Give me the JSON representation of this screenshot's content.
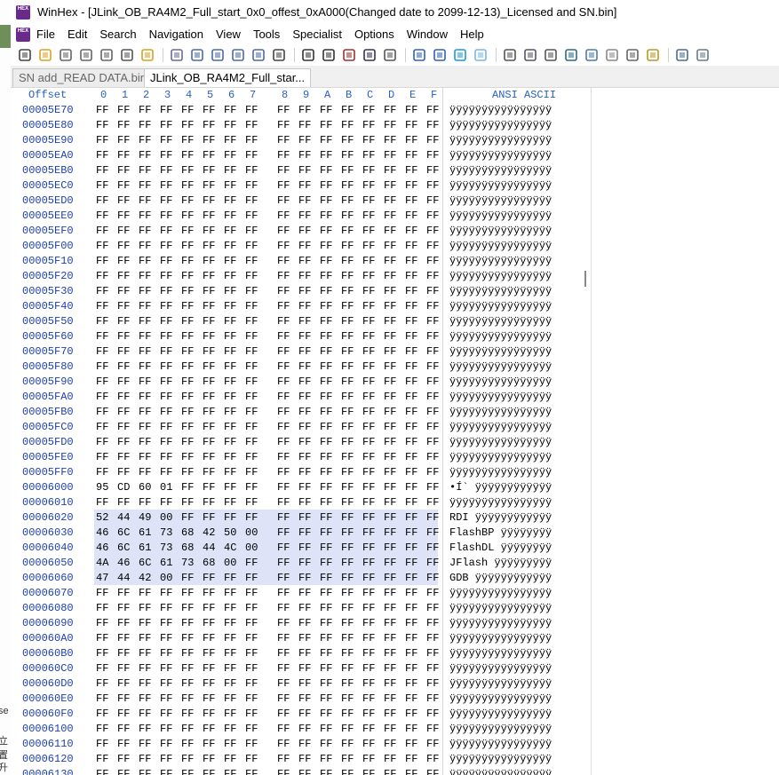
{
  "window": {
    "title": "WinHex - [JLink_OB_RA4M2_Full_start_0x0_offest_0xA000(Changed date to 2099-12-13)_Licensed and SN.bin]",
    "icon": "HEX",
    "icon_name": "winhex-app-icon"
  },
  "menu": [
    "File",
    "Edit",
    "Search",
    "Navigation",
    "View",
    "Tools",
    "Specialist",
    "Options",
    "Window",
    "Help"
  ],
  "toolbar": {
    "icons": [
      "new-file-icon",
      "open-icon",
      "save-icon",
      "save-all-icon",
      "print-icon",
      "properties-icon",
      "open-folder-icon",
      "undo-icon",
      "copy-icon",
      "paste-icon",
      "paste-special-icon",
      "copy-hex-icon",
      "binary-icon",
      "find-icon",
      "find-hex-icon",
      "replace-icon",
      "replace-hex-icon",
      "find-next-icon",
      "goto-offset-icon",
      "goto-end-icon",
      "back-icon",
      "forward-icon",
      "disk-icon",
      "open-disk-icon",
      "ram-icon",
      "calculator-icon",
      "search-icon",
      "hash-icon",
      "tools-icon",
      "options-icon",
      "layout-icon",
      "grid-icon"
    ]
  },
  "tabs": [
    {
      "label": "SN add_READ DATA.bin",
      "active": false
    },
    {
      "label": "JLink_OB_RA4M2_Full_star...",
      "active": true
    }
  ],
  "hex_editor": {
    "offset_label": "Offset",
    "columns": [
      "0",
      "1",
      "2",
      "3",
      "4",
      "5",
      "6",
      "7",
      "8",
      "9",
      "A",
      "B",
      "C",
      "D",
      "E",
      "F"
    ],
    "ascii_label": "ANSI ASCII",
    "rows": [
      {
        "offset": "00005E70",
        "bytes": [
          "FF",
          "FF",
          "FF",
          "FF",
          "FF",
          "FF",
          "FF",
          "FF",
          "FF",
          "FF",
          "FF",
          "FF",
          "FF",
          "FF",
          "FF",
          "FF"
        ],
        "ascii": "ÿÿÿÿÿÿÿÿÿÿÿÿÿÿÿÿ",
        "selected": false
      },
      {
        "offset": "00005E80",
        "bytes": [
          "FF",
          "FF",
          "FF",
          "FF",
          "FF",
          "FF",
          "FF",
          "FF",
          "FF",
          "FF",
          "FF",
          "FF",
          "FF",
          "FF",
          "FF",
          "FF"
        ],
        "ascii": "ÿÿÿÿÿÿÿÿÿÿÿÿÿÿÿÿ",
        "selected": false
      },
      {
        "offset": "00005E90",
        "bytes": [
          "FF",
          "FF",
          "FF",
          "FF",
          "FF",
          "FF",
          "FF",
          "FF",
          "FF",
          "FF",
          "FF",
          "FF",
          "FF",
          "FF",
          "FF",
          "FF"
        ],
        "ascii": "ÿÿÿÿÿÿÿÿÿÿÿÿÿÿÿÿ",
        "selected": false
      },
      {
        "offset": "00005EA0",
        "bytes": [
          "FF",
          "FF",
          "FF",
          "FF",
          "FF",
          "FF",
          "FF",
          "FF",
          "FF",
          "FF",
          "FF",
          "FF",
          "FF",
          "FF",
          "FF",
          "FF"
        ],
        "ascii": "ÿÿÿÿÿÿÿÿÿÿÿÿÿÿÿÿ",
        "selected": false
      },
      {
        "offset": "00005EB0",
        "bytes": [
          "FF",
          "FF",
          "FF",
          "FF",
          "FF",
          "FF",
          "FF",
          "FF",
          "FF",
          "FF",
          "FF",
          "FF",
          "FF",
          "FF",
          "FF",
          "FF"
        ],
        "ascii": "ÿÿÿÿÿÿÿÿÿÿÿÿÿÿÿÿ",
        "selected": false
      },
      {
        "offset": "00005EC0",
        "bytes": [
          "FF",
          "FF",
          "FF",
          "FF",
          "FF",
          "FF",
          "FF",
          "FF",
          "FF",
          "FF",
          "FF",
          "FF",
          "FF",
          "FF",
          "FF",
          "FF"
        ],
        "ascii": "ÿÿÿÿÿÿÿÿÿÿÿÿÿÿÿÿ",
        "selected": false
      },
      {
        "offset": "00005ED0",
        "bytes": [
          "FF",
          "FF",
          "FF",
          "FF",
          "FF",
          "FF",
          "FF",
          "FF",
          "FF",
          "FF",
          "FF",
          "FF",
          "FF",
          "FF",
          "FF",
          "FF"
        ],
        "ascii": "ÿÿÿÿÿÿÿÿÿÿÿÿÿÿÿÿ",
        "selected": false
      },
      {
        "offset": "00005EE0",
        "bytes": [
          "FF",
          "FF",
          "FF",
          "FF",
          "FF",
          "FF",
          "FF",
          "FF",
          "FF",
          "FF",
          "FF",
          "FF",
          "FF",
          "FF",
          "FF",
          "FF"
        ],
        "ascii": "ÿÿÿÿÿÿÿÿÿÿÿÿÿÿÿÿ",
        "selected": false
      },
      {
        "offset": "00005EF0",
        "bytes": [
          "FF",
          "FF",
          "FF",
          "FF",
          "FF",
          "FF",
          "FF",
          "FF",
          "FF",
          "FF",
          "FF",
          "FF",
          "FF",
          "FF",
          "FF",
          "FF"
        ],
        "ascii": "ÿÿÿÿÿÿÿÿÿÿÿÿÿÿÿÿ",
        "selected": false
      },
      {
        "offset": "00005F00",
        "bytes": [
          "FF",
          "FF",
          "FF",
          "FF",
          "FF",
          "FF",
          "FF",
          "FF",
          "FF",
          "FF",
          "FF",
          "FF",
          "FF",
          "FF",
          "FF",
          "FF"
        ],
        "ascii": "ÿÿÿÿÿÿÿÿÿÿÿÿÿÿÿÿ",
        "selected": false
      },
      {
        "offset": "00005F10",
        "bytes": [
          "FF",
          "FF",
          "FF",
          "FF",
          "FF",
          "FF",
          "FF",
          "FF",
          "FF",
          "FF",
          "FF",
          "FF",
          "FF",
          "FF",
          "FF",
          "FF"
        ],
        "ascii": "ÿÿÿÿÿÿÿÿÿÿÿÿÿÿÿÿ",
        "selected": false
      },
      {
        "offset": "00005F20",
        "bytes": [
          "FF",
          "FF",
          "FF",
          "FF",
          "FF",
          "FF",
          "FF",
          "FF",
          "FF",
          "FF",
          "FF",
          "FF",
          "FF",
          "FF",
          "FF",
          "FF"
        ],
        "ascii": "ÿÿÿÿÿÿÿÿÿÿÿÿÿÿÿÿ",
        "selected": false
      },
      {
        "offset": "00005F30",
        "bytes": [
          "FF",
          "FF",
          "FF",
          "FF",
          "FF",
          "FF",
          "FF",
          "FF",
          "FF",
          "FF",
          "FF",
          "FF",
          "FF",
          "FF",
          "FF",
          "FF"
        ],
        "ascii": "ÿÿÿÿÿÿÿÿÿÿÿÿÿÿÿÿ",
        "selected": false
      },
      {
        "offset": "00005F40",
        "bytes": [
          "FF",
          "FF",
          "FF",
          "FF",
          "FF",
          "FF",
          "FF",
          "FF",
          "FF",
          "FF",
          "FF",
          "FF",
          "FF",
          "FF",
          "FF",
          "FF"
        ],
        "ascii": "ÿÿÿÿÿÿÿÿÿÿÿÿÿÿÿÿ",
        "selected": false
      },
      {
        "offset": "00005F50",
        "bytes": [
          "FF",
          "FF",
          "FF",
          "FF",
          "FF",
          "FF",
          "FF",
          "FF",
          "FF",
          "FF",
          "FF",
          "FF",
          "FF",
          "FF",
          "FF",
          "FF"
        ],
        "ascii": "ÿÿÿÿÿÿÿÿÿÿÿÿÿÿÿÿ",
        "selected": false
      },
      {
        "offset": "00005F60",
        "bytes": [
          "FF",
          "FF",
          "FF",
          "FF",
          "FF",
          "FF",
          "FF",
          "FF",
          "FF",
          "FF",
          "FF",
          "FF",
          "FF",
          "FF",
          "FF",
          "FF"
        ],
        "ascii": "ÿÿÿÿÿÿÿÿÿÿÿÿÿÿÿÿ",
        "selected": false
      },
      {
        "offset": "00005F70",
        "bytes": [
          "FF",
          "FF",
          "FF",
          "FF",
          "FF",
          "FF",
          "FF",
          "FF",
          "FF",
          "FF",
          "FF",
          "FF",
          "FF",
          "FF",
          "FF",
          "FF"
        ],
        "ascii": "ÿÿÿÿÿÿÿÿÿÿÿÿÿÿÿÿ",
        "selected": false
      },
      {
        "offset": "00005F80",
        "bytes": [
          "FF",
          "FF",
          "FF",
          "FF",
          "FF",
          "FF",
          "FF",
          "FF",
          "FF",
          "FF",
          "FF",
          "FF",
          "FF",
          "FF",
          "FF",
          "FF"
        ],
        "ascii": "ÿÿÿÿÿÿÿÿÿÿÿÿÿÿÿÿ",
        "selected": false
      },
      {
        "offset": "00005F90",
        "bytes": [
          "FF",
          "FF",
          "FF",
          "FF",
          "FF",
          "FF",
          "FF",
          "FF",
          "FF",
          "FF",
          "FF",
          "FF",
          "FF",
          "FF",
          "FF",
          "FF"
        ],
        "ascii": "ÿÿÿÿÿÿÿÿÿÿÿÿÿÿÿÿ",
        "selected": false
      },
      {
        "offset": "00005FA0",
        "bytes": [
          "FF",
          "FF",
          "FF",
          "FF",
          "FF",
          "FF",
          "FF",
          "FF",
          "FF",
          "FF",
          "FF",
          "FF",
          "FF",
          "FF",
          "FF",
          "FF"
        ],
        "ascii": "ÿÿÿÿÿÿÿÿÿÿÿÿÿÿÿÿ",
        "selected": false
      },
      {
        "offset": "00005FB0",
        "bytes": [
          "FF",
          "FF",
          "FF",
          "FF",
          "FF",
          "FF",
          "FF",
          "FF",
          "FF",
          "FF",
          "FF",
          "FF",
          "FF",
          "FF",
          "FF",
          "FF"
        ],
        "ascii": "ÿÿÿÿÿÿÿÿÿÿÿÿÿÿÿÿ",
        "selected": false
      },
      {
        "offset": "00005FC0",
        "bytes": [
          "FF",
          "FF",
          "FF",
          "FF",
          "FF",
          "FF",
          "FF",
          "FF",
          "FF",
          "FF",
          "FF",
          "FF",
          "FF",
          "FF",
          "FF",
          "FF"
        ],
        "ascii": "ÿÿÿÿÿÿÿÿÿÿÿÿÿÿÿÿ",
        "selected": false
      },
      {
        "offset": "00005FD0",
        "bytes": [
          "FF",
          "FF",
          "FF",
          "FF",
          "FF",
          "FF",
          "FF",
          "FF",
          "FF",
          "FF",
          "FF",
          "FF",
          "FF",
          "FF",
          "FF",
          "FF"
        ],
        "ascii": "ÿÿÿÿÿÿÿÿÿÿÿÿÿÿÿÿ",
        "selected": false
      },
      {
        "offset": "00005FE0",
        "bytes": [
          "FF",
          "FF",
          "FF",
          "FF",
          "FF",
          "FF",
          "FF",
          "FF",
          "FF",
          "FF",
          "FF",
          "FF",
          "FF",
          "FF",
          "FF",
          "FF"
        ],
        "ascii": "ÿÿÿÿÿÿÿÿÿÿÿÿÿÿÿÿ",
        "selected": false
      },
      {
        "offset": "00005FF0",
        "bytes": [
          "FF",
          "FF",
          "FF",
          "FF",
          "FF",
          "FF",
          "FF",
          "FF",
          "FF",
          "FF",
          "FF",
          "FF",
          "FF",
          "FF",
          "FF",
          "FF"
        ],
        "ascii": "ÿÿÿÿÿÿÿÿÿÿÿÿÿÿÿÿ",
        "selected": false
      },
      {
        "offset": "00006000",
        "bytes": [
          "95",
          "CD",
          "60",
          "01",
          "FF",
          "FF",
          "FF",
          "FF",
          "FF",
          "FF",
          "FF",
          "FF",
          "FF",
          "FF",
          "FF",
          "FF"
        ],
        "ascii": "•Í` ÿÿÿÿÿÿÿÿÿÿÿÿ",
        "selected": false
      },
      {
        "offset": "00006010",
        "bytes": [
          "FF",
          "FF",
          "FF",
          "FF",
          "FF",
          "FF",
          "FF",
          "FF",
          "FF",
          "FF",
          "FF",
          "FF",
          "FF",
          "FF",
          "FF",
          "FF"
        ],
        "ascii": "ÿÿÿÿÿÿÿÿÿÿÿÿÿÿÿÿ",
        "selected": false
      },
      {
        "offset": "00006020",
        "bytes": [
          "52",
          "44",
          "49",
          "00",
          "FF",
          "FF",
          "FF",
          "FF",
          "FF",
          "FF",
          "FF",
          "FF",
          "FF",
          "FF",
          "FF",
          "FF"
        ],
        "ascii": "RDI ÿÿÿÿÿÿÿÿÿÿÿÿ",
        "selected": true
      },
      {
        "offset": "00006030",
        "bytes": [
          "46",
          "6C",
          "61",
          "73",
          "68",
          "42",
          "50",
          "00",
          "FF",
          "FF",
          "FF",
          "FF",
          "FF",
          "FF",
          "FF",
          "FF"
        ],
        "ascii": "FlashBP ÿÿÿÿÿÿÿÿ",
        "selected": true
      },
      {
        "offset": "00006040",
        "bytes": [
          "46",
          "6C",
          "61",
          "73",
          "68",
          "44",
          "4C",
          "00",
          "FF",
          "FF",
          "FF",
          "FF",
          "FF",
          "FF",
          "FF",
          "FF"
        ],
        "ascii": "FlashDL ÿÿÿÿÿÿÿÿ",
        "selected": true
      },
      {
        "offset": "00006050",
        "bytes": [
          "4A",
          "46",
          "6C",
          "61",
          "73",
          "68",
          "00",
          "FF",
          "FF",
          "FF",
          "FF",
          "FF",
          "FF",
          "FF",
          "FF",
          "FF"
        ],
        "ascii": "JFlash ÿÿÿÿÿÿÿÿÿ",
        "selected": true
      },
      {
        "offset": "00006060",
        "bytes": [
          "47",
          "44",
          "42",
          "00",
          "FF",
          "FF",
          "FF",
          "FF",
          "FF",
          "FF",
          "FF",
          "FF",
          "FF",
          "FF",
          "FF",
          "FF"
        ],
        "ascii": "GDB ÿÿÿÿÿÿÿÿÿÿÿÿ",
        "selected": true
      },
      {
        "offset": "00006070",
        "bytes": [
          "FF",
          "FF",
          "FF",
          "FF",
          "FF",
          "FF",
          "FF",
          "FF",
          "FF",
          "FF",
          "FF",
          "FF",
          "FF",
          "FF",
          "FF",
          "FF"
        ],
        "ascii": "ÿÿÿÿÿÿÿÿÿÿÿÿÿÿÿÿ",
        "selected": false
      },
      {
        "offset": "00006080",
        "bytes": [
          "FF",
          "FF",
          "FF",
          "FF",
          "FF",
          "FF",
          "FF",
          "FF",
          "FF",
          "FF",
          "FF",
          "FF",
          "FF",
          "FF",
          "FF",
          "FF"
        ],
        "ascii": "ÿÿÿÿÿÿÿÿÿÿÿÿÿÿÿÿ",
        "selected": false
      },
      {
        "offset": "00006090",
        "bytes": [
          "FF",
          "FF",
          "FF",
          "FF",
          "FF",
          "FF",
          "FF",
          "FF",
          "FF",
          "FF",
          "FF",
          "FF",
          "FF",
          "FF",
          "FF",
          "FF"
        ],
        "ascii": "ÿÿÿÿÿÿÿÿÿÿÿÿÿÿÿÿ",
        "selected": false
      },
      {
        "offset": "000060A0",
        "bytes": [
          "FF",
          "FF",
          "FF",
          "FF",
          "FF",
          "FF",
          "FF",
          "FF",
          "FF",
          "FF",
          "FF",
          "FF",
          "FF",
          "FF",
          "FF",
          "FF"
        ],
        "ascii": "ÿÿÿÿÿÿÿÿÿÿÿÿÿÿÿÿ",
        "selected": false
      },
      {
        "offset": "000060B0",
        "bytes": [
          "FF",
          "FF",
          "FF",
          "FF",
          "FF",
          "FF",
          "FF",
          "FF",
          "FF",
          "FF",
          "FF",
          "FF",
          "FF",
          "FF",
          "FF",
          "FF"
        ],
        "ascii": "ÿÿÿÿÿÿÿÿÿÿÿÿÿÿÿÿ",
        "selected": false
      },
      {
        "offset": "000060C0",
        "bytes": [
          "FF",
          "FF",
          "FF",
          "FF",
          "FF",
          "FF",
          "FF",
          "FF",
          "FF",
          "FF",
          "FF",
          "FF",
          "FF",
          "FF",
          "FF",
          "FF"
        ],
        "ascii": "ÿÿÿÿÿÿÿÿÿÿÿÿÿÿÿÿ",
        "selected": false
      },
      {
        "offset": "000060D0",
        "bytes": [
          "FF",
          "FF",
          "FF",
          "FF",
          "FF",
          "FF",
          "FF",
          "FF",
          "FF",
          "FF",
          "FF",
          "FF",
          "FF",
          "FF",
          "FF",
          "FF"
        ],
        "ascii": "ÿÿÿÿÿÿÿÿÿÿÿÿÿÿÿÿ",
        "selected": false
      },
      {
        "offset": "000060E0",
        "bytes": [
          "FF",
          "FF",
          "FF",
          "FF",
          "FF",
          "FF",
          "FF",
          "FF",
          "FF",
          "FF",
          "FF",
          "FF",
          "FF",
          "FF",
          "FF",
          "FF"
        ],
        "ascii": "ÿÿÿÿÿÿÿÿÿÿÿÿÿÿÿÿ",
        "selected": false
      },
      {
        "offset": "000060F0",
        "bytes": [
          "FF",
          "FF",
          "FF",
          "FF",
          "FF",
          "FF",
          "FF",
          "FF",
          "FF",
          "FF",
          "FF",
          "FF",
          "FF",
          "FF",
          "FF",
          "FF"
        ],
        "ascii": "ÿÿÿÿÿÿÿÿÿÿÿÿÿÿÿÿ",
        "selected": false
      },
      {
        "offset": "00006100",
        "bytes": [
          "FF",
          "FF",
          "FF",
          "FF",
          "FF",
          "FF",
          "FF",
          "FF",
          "FF",
          "FF",
          "FF",
          "FF",
          "FF",
          "FF",
          "FF",
          "FF"
        ],
        "ascii": "ÿÿÿÿÿÿÿÿÿÿÿÿÿÿÿÿ",
        "selected": false
      },
      {
        "offset": "00006110",
        "bytes": [
          "FF",
          "FF",
          "FF",
          "FF",
          "FF",
          "FF",
          "FF",
          "FF",
          "FF",
          "FF",
          "FF",
          "FF",
          "FF",
          "FF",
          "FF",
          "FF"
        ],
        "ascii": "ÿÿÿÿÿÿÿÿÿÿÿÿÿÿÿÿ",
        "selected": false
      },
      {
        "offset": "00006120",
        "bytes": [
          "FF",
          "FF",
          "FF",
          "FF",
          "FF",
          "FF",
          "FF",
          "FF",
          "FF",
          "FF",
          "FF",
          "FF",
          "FF",
          "FF",
          "FF",
          "FF"
        ],
        "ascii": "ÿÿÿÿÿÿÿÿÿÿÿÿÿÿÿÿ",
        "selected": false
      },
      {
        "offset": "00006130",
        "bytes": [
          "FF",
          "FF",
          "FF",
          "FF",
          "FF",
          "FF",
          "FF",
          "FF",
          "FF",
          "FF",
          "FF",
          "FF",
          "FF",
          "FF",
          "FF",
          "FF"
        ],
        "ascii": "ÿÿÿÿÿÿÿÿÿÿÿÿÿÿÿÿ",
        "selected": false
      }
    ]
  },
  "colors": {
    "offset_text": "#1c3fb0",
    "header_text": "#2a60c0",
    "selection": "#dfe3f8",
    "app_icon": "#6a2a8a"
  },
  "desktop_fragments": [
    "se",
    "立置",
    "升级"
  ]
}
